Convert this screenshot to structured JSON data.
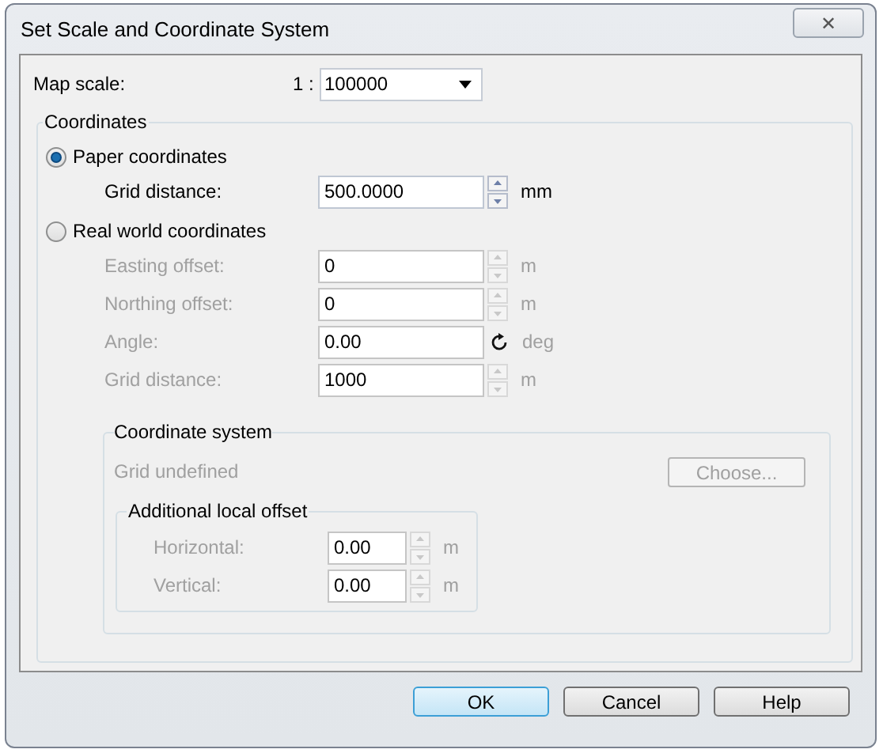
{
  "window": {
    "title": "Set Scale and Coordinate System",
    "close": "✕"
  },
  "map_scale": {
    "label": "Map scale:",
    "ratio": "1 :",
    "value": "100000"
  },
  "coordinates": {
    "title": "Coordinates",
    "options": [
      {
        "label": "Paper coordinates",
        "selected": true,
        "fields": [
          {
            "kind": "spin",
            "label": "Grid distance:",
            "value": "500.0000",
            "unit": "mm",
            "disabled": false
          }
        ]
      },
      {
        "label": "Real world coordinates",
        "selected": false,
        "fields": [
          {
            "kind": "spin",
            "label": "Easting offset:",
            "value": "0",
            "unit": "m",
            "disabled": true
          },
          {
            "kind": "spin",
            "label": "Northing offset:",
            "value": "0",
            "unit": "m",
            "disabled": true
          },
          {
            "kind": "rotate",
            "label": "Angle:",
            "value": "0.00",
            "unit": "deg",
            "disabled": true
          },
          {
            "kind": "spin",
            "label": "Grid distance:",
            "value": "1000",
            "unit": "m",
            "disabled": true
          }
        ]
      }
    ]
  },
  "coordinate_system": {
    "title": "Coordinate system",
    "status": "Grid undefined",
    "choose_button": "Choose...",
    "disabled": true,
    "local_offset": {
      "title": "Additional local offset",
      "fields": [
        {
          "kind": "spin",
          "label": "Horizontal:",
          "value": "0.00",
          "unit": "m",
          "disabled": true
        },
        {
          "kind": "spin",
          "label": "Vertical:",
          "value": "0.00",
          "unit": "m",
          "disabled": true
        }
      ]
    }
  },
  "buttons": [
    {
      "label": "OK",
      "default": true
    },
    {
      "label": "Cancel",
      "default": false
    },
    {
      "label": "Help",
      "default": false
    }
  ]
}
